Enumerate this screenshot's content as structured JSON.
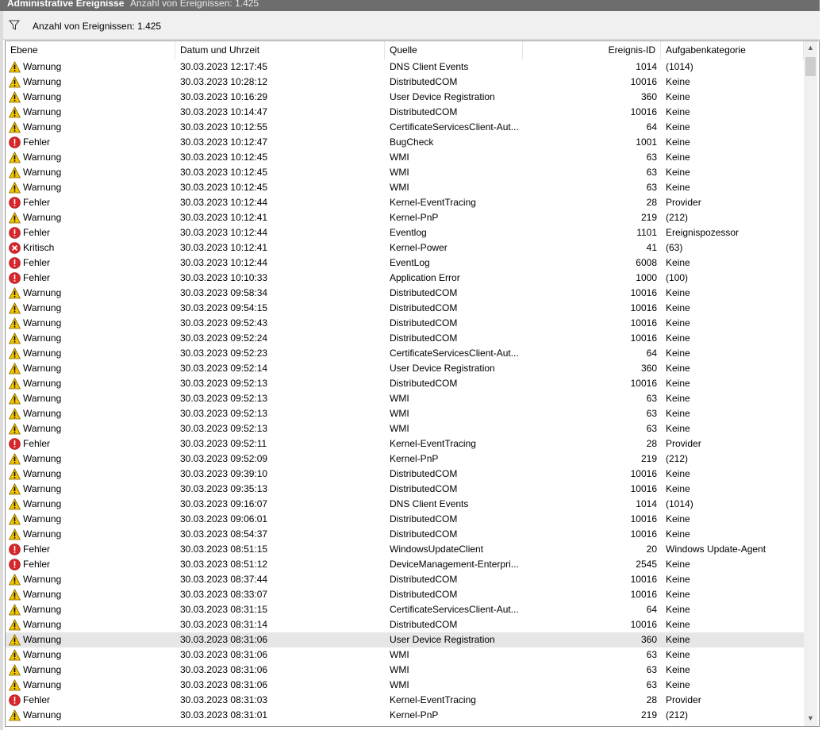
{
  "title": "Administrative Ereignisse",
  "title_count": "Anzahl von Ereignissen: 1.425",
  "filter_text": "Anzahl von Ereignissen: 1.425",
  "colors": {
    "titlebar": "#6d6d6d",
    "warning": "#f5c400",
    "error": "#d9262b",
    "selected_row": "#e6e6e6"
  },
  "columns": [
    "Ebene",
    "Datum und Uhrzeit",
    "Quelle",
    "Ereignis-ID",
    "Aufgabenkategorie"
  ],
  "events": [
    {
      "level": "Warnung",
      "icon": "warning",
      "date": "30.03.2023 12:17:45",
      "source": "DNS Client Events",
      "id": "1014",
      "task": "(1014)"
    },
    {
      "level": "Warnung",
      "icon": "warning",
      "date": "30.03.2023 10:28:12",
      "source": "DistributedCOM",
      "id": "10016",
      "task": "Keine"
    },
    {
      "level": "Warnung",
      "icon": "warning",
      "date": "30.03.2023 10:16:29",
      "source": "User Device Registration",
      "id": "360",
      "task": "Keine"
    },
    {
      "level": "Warnung",
      "icon": "warning",
      "date": "30.03.2023 10:14:47",
      "source": "DistributedCOM",
      "id": "10016",
      "task": "Keine"
    },
    {
      "level": "Warnung",
      "icon": "warning",
      "date": "30.03.2023 10:12:55",
      "source": "CertificateServicesClient-Aut...",
      "id": "64",
      "task": "Keine"
    },
    {
      "level": "Fehler",
      "icon": "error",
      "date": "30.03.2023 10:12:47",
      "source": "BugCheck",
      "id": "1001",
      "task": "Keine"
    },
    {
      "level": "Warnung",
      "icon": "warning",
      "date": "30.03.2023 10:12:45",
      "source": "WMI",
      "id": "63",
      "task": "Keine"
    },
    {
      "level": "Warnung",
      "icon": "warning",
      "date": "30.03.2023 10:12:45",
      "source": "WMI",
      "id": "63",
      "task": "Keine"
    },
    {
      "level": "Warnung",
      "icon": "warning",
      "date": "30.03.2023 10:12:45",
      "source": "WMI",
      "id": "63",
      "task": "Keine"
    },
    {
      "level": "Fehler",
      "icon": "error",
      "date": "30.03.2023 10:12:44",
      "source": "Kernel-EventTracing",
      "id": "28",
      "task": "Provider"
    },
    {
      "level": "Warnung",
      "icon": "warning",
      "date": "30.03.2023 10:12:41",
      "source": "Kernel-PnP",
      "id": "219",
      "task": "(212)"
    },
    {
      "level": "Fehler",
      "icon": "error",
      "date": "30.03.2023 10:12:44",
      "source": "Eventlog",
      "id": "1101",
      "task": "Ereignispozessor"
    },
    {
      "level": "Kritisch",
      "icon": "critical",
      "date": "30.03.2023 10:12:41",
      "source": "Kernel-Power",
      "id": "41",
      "task": "(63)"
    },
    {
      "level": "Fehler",
      "icon": "error",
      "date": "30.03.2023 10:12:44",
      "source": "EventLog",
      "id": "6008",
      "task": "Keine"
    },
    {
      "level": "Fehler",
      "icon": "error",
      "date": "30.03.2023 10:10:33",
      "source": "Application Error",
      "id": "1000",
      "task": "(100)"
    },
    {
      "level": "Warnung",
      "icon": "warning",
      "date": "30.03.2023 09:58:34",
      "source": "DistributedCOM",
      "id": "10016",
      "task": "Keine"
    },
    {
      "level": "Warnung",
      "icon": "warning",
      "date": "30.03.2023 09:54:15",
      "source": "DistributedCOM",
      "id": "10016",
      "task": "Keine"
    },
    {
      "level": "Warnung",
      "icon": "warning",
      "date": "30.03.2023 09:52:43",
      "source": "DistributedCOM",
      "id": "10016",
      "task": "Keine"
    },
    {
      "level": "Warnung",
      "icon": "warning",
      "date": "30.03.2023 09:52:24",
      "source": "DistributedCOM",
      "id": "10016",
      "task": "Keine"
    },
    {
      "level": "Warnung",
      "icon": "warning",
      "date": "30.03.2023 09:52:23",
      "source": "CertificateServicesClient-Aut...",
      "id": "64",
      "task": "Keine"
    },
    {
      "level": "Warnung",
      "icon": "warning",
      "date": "30.03.2023 09:52:14",
      "source": "User Device Registration",
      "id": "360",
      "task": "Keine"
    },
    {
      "level": "Warnung",
      "icon": "warning",
      "date": "30.03.2023 09:52:13",
      "source": "DistributedCOM",
      "id": "10016",
      "task": "Keine"
    },
    {
      "level": "Warnung",
      "icon": "warning",
      "date": "30.03.2023 09:52:13",
      "source": "WMI",
      "id": "63",
      "task": "Keine"
    },
    {
      "level": "Warnung",
      "icon": "warning",
      "date": "30.03.2023 09:52:13",
      "source": "WMI",
      "id": "63",
      "task": "Keine"
    },
    {
      "level": "Warnung",
      "icon": "warning",
      "date": "30.03.2023 09:52:13",
      "source": "WMI",
      "id": "63",
      "task": "Keine"
    },
    {
      "level": "Fehler",
      "icon": "error",
      "date": "30.03.2023 09:52:11",
      "source": "Kernel-EventTracing",
      "id": "28",
      "task": "Provider"
    },
    {
      "level": "Warnung",
      "icon": "warning",
      "date": "30.03.2023 09:52:09",
      "source": "Kernel-PnP",
      "id": "219",
      "task": "(212)"
    },
    {
      "level": "Warnung",
      "icon": "warning",
      "date": "30.03.2023 09:39:10",
      "source": "DistributedCOM",
      "id": "10016",
      "task": "Keine"
    },
    {
      "level": "Warnung",
      "icon": "warning",
      "date": "30.03.2023 09:35:13",
      "source": "DistributedCOM",
      "id": "10016",
      "task": "Keine"
    },
    {
      "level": "Warnung",
      "icon": "warning",
      "date": "30.03.2023 09:16:07",
      "source": "DNS Client Events",
      "id": "1014",
      "task": "(1014)"
    },
    {
      "level": "Warnung",
      "icon": "warning",
      "date": "30.03.2023 09:06:01",
      "source": "DistributedCOM",
      "id": "10016",
      "task": "Keine"
    },
    {
      "level": "Warnung",
      "icon": "warning",
      "date": "30.03.2023 08:54:37",
      "source": "DistributedCOM",
      "id": "10016",
      "task": "Keine"
    },
    {
      "level": "Fehler",
      "icon": "error",
      "date": "30.03.2023 08:51:15",
      "source": "WindowsUpdateClient",
      "id": "20",
      "task": "Windows Update-Agent"
    },
    {
      "level": "Fehler",
      "icon": "error",
      "date": "30.03.2023 08:51:12",
      "source": "DeviceManagement-Enterpri...",
      "id": "2545",
      "task": "Keine"
    },
    {
      "level": "Warnung",
      "icon": "warning",
      "date": "30.03.2023 08:37:44",
      "source": "DistributedCOM",
      "id": "10016",
      "task": "Keine"
    },
    {
      "level": "Warnung",
      "icon": "warning",
      "date": "30.03.2023 08:33:07",
      "source": "DistributedCOM",
      "id": "10016",
      "task": "Keine"
    },
    {
      "level": "Warnung",
      "icon": "warning",
      "date": "30.03.2023 08:31:15",
      "source": "CertificateServicesClient-Aut...",
      "id": "64",
      "task": "Keine"
    },
    {
      "level": "Warnung",
      "icon": "warning",
      "date": "30.03.2023 08:31:14",
      "source": "DistributedCOM",
      "id": "10016",
      "task": "Keine"
    },
    {
      "level": "Warnung",
      "icon": "warning",
      "date": "30.03.2023 08:31:06",
      "source": "User Device Registration",
      "id": "360",
      "task": "Keine",
      "selected": true
    },
    {
      "level": "Warnung",
      "icon": "warning",
      "date": "30.03.2023 08:31:06",
      "source": "WMI",
      "id": "63",
      "task": "Keine"
    },
    {
      "level": "Warnung",
      "icon": "warning",
      "date": "30.03.2023 08:31:06",
      "source": "WMI",
      "id": "63",
      "task": "Keine"
    },
    {
      "level": "Warnung",
      "icon": "warning",
      "date": "30.03.2023 08:31:06",
      "source": "WMI",
      "id": "63",
      "task": "Keine"
    },
    {
      "level": "Fehler",
      "icon": "error",
      "date": "30.03.2023 08:31:03",
      "source": "Kernel-EventTracing",
      "id": "28",
      "task": "Provider"
    },
    {
      "level": "Warnung",
      "icon": "warning",
      "date": "30.03.2023 08:31:01",
      "source": "Kernel-PnP",
      "id": "219",
      "task": "(212)"
    }
  ]
}
